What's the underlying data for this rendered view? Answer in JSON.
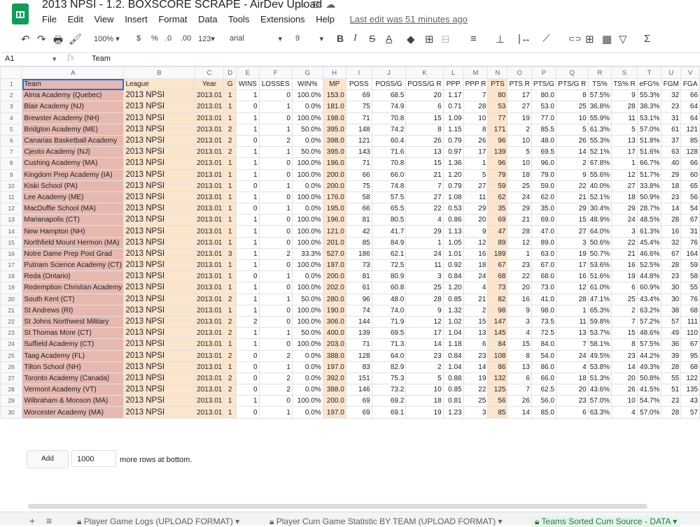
{
  "doc": {
    "title": "2013 NPSI - 1.2. BOXSCORE SCRAPE - AirDev Upload",
    "icons": [
      "star-icon",
      "move-to-folder-icon",
      "cloud-status-icon"
    ]
  },
  "menu": {
    "items": [
      "File",
      "Edit",
      "View",
      "Insert",
      "Format",
      "Data",
      "Tools",
      "Extensions",
      "Help"
    ],
    "last_edit": "Last edit was 51 minutes ago"
  },
  "toolbar": {
    "undo": "↶",
    "redo": "↷",
    "print": "🖶",
    "paint": "🖌",
    "zoom": "100%",
    "currency": "$",
    "percent": "%",
    "dec_less": ".0",
    "dec_more": ".00",
    "format": "123",
    "font": "arial",
    "size": "9",
    "bold": "B",
    "italic": "I",
    "strike": "S",
    "underline": "A",
    "fill": "◆",
    "borders": "⊞",
    "merge": "⊟",
    "halign": "≡",
    "valign": "⊥",
    "wrap": "|↔",
    "rotate": "⟋",
    "link": "⊂⊃",
    "comment": "⊞",
    "chart": "▦",
    "filter": "▽",
    "functions": "Σ"
  },
  "formula_bar": {
    "cell_ref": "A1",
    "value": "Team"
  },
  "columns": [
    "A",
    "B",
    "C",
    "D",
    "E",
    "F",
    "G",
    "H",
    "I",
    "J",
    "K",
    "L",
    "M",
    "N",
    "O",
    "P",
    "Q",
    "R",
    "S",
    "T",
    "U",
    "V"
  ],
  "headers": [
    "Team",
    "League",
    "Year",
    "G",
    "WINS",
    "LOSSES",
    "WIN%",
    "MP",
    "POSS",
    "POSS/G",
    "POSS/G R",
    "PPP",
    "PPP R",
    "PTS",
    "PTS R",
    "PTS/G",
    "PTS/G R",
    "TS%",
    "TS% R",
    "eFG%",
    "FGM",
    "FGA"
  ],
  "rows": [
    [
      "Alma Academy (Quebec)",
      "2013 NPSI",
      "2013.01",
      "1",
      "1",
      "0",
      "100.0%",
      "153.0",
      "69",
      "68.5",
      "20",
      "1.17",
      "7",
      "80",
      "17",
      "80.0",
      "8",
      "57.5%",
      "9",
      "55.3%",
      "32",
      "66"
    ],
    [
      "Blair Academy (NJ)",
      "2013 NPSI",
      "2013.01",
      "1",
      "0",
      "1",
      "0.0%",
      "181.0",
      "75",
      "74.9",
      "6",
      "0.71",
      "28",
      "53",
      "27",
      "53.0",
      "25",
      "36.8%",
      "28",
      "38.3%",
      "23",
      "64"
    ],
    [
      "Brewster Academy (NH)",
      "2013 NPSI",
      "2013.01",
      "1",
      "1",
      "0",
      "100.0%",
      "198.0",
      "71",
      "70.8",
      "15",
      "1.09",
      "10",
      "77",
      "19",
      "77.0",
      "10",
      "55.9%",
      "11",
      "53.1%",
      "31",
      "64"
    ],
    [
      "Bridgton Academy (ME)",
      "2013 NPSI",
      "2013.01",
      "2",
      "1",
      "1",
      "50.0%",
      "395.0",
      "148",
      "74.2",
      "8",
      "1.15",
      "8",
      "171",
      "2",
      "85.5",
      "5",
      "61.3%",
      "5",
      "57.0%",
      "61",
      "121"
    ],
    [
      "Canarias Basketball Academy",
      "2013 NPSI",
      "2013.01",
      "2",
      "0",
      "2",
      "0.0%",
      "398.0",
      "121",
      "60.4",
      "26",
      "0.79",
      "26",
      "96",
      "10",
      "48.0",
      "26",
      "55.3%",
      "13",
      "51.8%",
      "37",
      "85"
    ],
    [
      "Cjeoto Academy (NJ)",
      "2013 NPSI",
      "2013.01",
      "2",
      "1",
      "1",
      "50.0%",
      "395.0",
      "143",
      "71.6",
      "13",
      "0.97",
      "17",
      "139",
      "5",
      "69.5",
      "14",
      "52.1%",
      "17",
      "51.6%",
      "63",
      "128"
    ],
    [
      "Cushing Academy (MA)",
      "2013 NPSI",
      "2013.01",
      "1",
      "1",
      "0",
      "100.0%",
      "196.0",
      "71",
      "70.8",
      "15",
      "1.36",
      "1",
      "96",
      "10",
      "96.0",
      "2",
      "67.8%",
      "1",
      "66.7%",
      "40",
      "66"
    ],
    [
      "Kingdom Prep Academy (IA)",
      "2013 NPSI",
      "2013.01",
      "1",
      "1",
      "0",
      "100.0%",
      "200.0",
      "66",
      "66.0",
      "21",
      "1.20",
      "5",
      "79",
      "18",
      "79.0",
      "9",
      "55.6%",
      "12",
      "51.7%",
      "29",
      "60"
    ],
    [
      "Kiski School (PA)",
      "2013 NPSI",
      "2013.01",
      "1",
      "0",
      "1",
      "0.0%",
      "200.0",
      "75",
      "74.8",
      "7",
      "0.79",
      "27",
      "59",
      "25",
      "59.0",
      "22",
      "40.0%",
      "27",
      "33.8%",
      "18",
      "65"
    ],
    [
      "Lee Academy (ME)",
      "2013 NPSI",
      "2013.01",
      "1",
      "1",
      "0",
      "100.0%",
      "176.0",
      "58",
      "57.5",
      "27",
      "1.08",
      "11",
      "62",
      "24",
      "62.0",
      "21",
      "52.1%",
      "18",
      "50.9%",
      "23",
      "56"
    ],
    [
      "MacDuffie School (MA)",
      "2013 NPSI",
      "2013.01",
      "1",
      "0",
      "1",
      "0.0%",
      "195.0",
      "66",
      "65.5",
      "22",
      "0.53",
      "29",
      "35",
      "29",
      "35.0",
      "29",
      "30.4%",
      "29",
      "28.7%",
      "14",
      "54"
    ],
    [
      "Marianapolis (CT)",
      "2013 NPSI",
      "2013.01",
      "1",
      "1",
      "0",
      "100.0%",
      "196.0",
      "81",
      "80.5",
      "4",
      "0.86",
      "20",
      "69",
      "21",
      "69.0",
      "15",
      "48.9%",
      "24",
      "48.5%",
      "28",
      "67"
    ],
    [
      "New Hampton (NH)",
      "2013 NPSI",
      "2013.01",
      "1",
      "1",
      "0",
      "100.0%",
      "121.0",
      "42",
      "41.7",
      "29",
      "1.13",
      "9",
      "47",
      "28",
      "47.0",
      "27",
      "64.0%",
      "3",
      "61.3%",
      "16",
      "31"
    ],
    [
      "Northfield Mount Hermon (MA)",
      "2013 NPSI",
      "2013.01",
      "1",
      "1",
      "0",
      "100.0%",
      "201.0",
      "85",
      "84.9",
      "1",
      "1.05",
      "12",
      "89",
      "12",
      "89.0",
      "3",
      "50.6%",
      "22",
      "45.4%",
      "32",
      "76"
    ],
    [
      "Notre Dame Prep Post Grad",
      "2013 NPSI",
      "2013.01",
      "3",
      "1",
      "2",
      "33.3%",
      "527.0",
      "186",
      "62.1",
      "24",
      "1.01",
      "16",
      "189",
      "1",
      "63.0",
      "19",
      "50.7%",
      "21",
      "46.6%",
      "67",
      "164"
    ],
    [
      "Putnam Science Academy (CT)",
      "2013 NPSI",
      "2013.01",
      "1",
      "1",
      "0",
      "100.0%",
      "197.0",
      "73",
      "72.5",
      "11",
      "0.92",
      "18",
      "67",
      "23",
      "67.0",
      "17",
      "53.6%",
      "16",
      "52.5%",
      "28",
      "59"
    ],
    [
      "Reda (Ontario)",
      "2013 NPSI",
      "2013.01",
      "1",
      "0",
      "1",
      "0.0%",
      "200.0",
      "81",
      "80.9",
      "3",
      "0.84",
      "24",
      "68",
      "22",
      "68.0",
      "16",
      "51.6%",
      "19",
      "44.8%",
      "23",
      "58"
    ],
    [
      "Redemption Christian Academy",
      "2013 NPSI",
      "2013.01",
      "1",
      "1",
      "0",
      "100.0%",
      "202.0",
      "61",
      "60.8",
      "25",
      "1.20",
      "4",
      "73",
      "20",
      "73.0",
      "12",
      "61.0%",
      "6",
      "60.9%",
      "30",
      "55"
    ],
    [
      "South Kent (CT)",
      "2013 NPSI",
      "2013.01",
      "2",
      "1",
      "1",
      "50.0%",
      "280.0",
      "96",
      "48.0",
      "28",
      "0.85",
      "21",
      "82",
      "16",
      "41.0",
      "28",
      "47.1%",
      "25",
      "43.4%",
      "30",
      "76"
    ],
    [
      "St Andrews (RI)",
      "2013 NPSI",
      "2013.01",
      "1",
      "1",
      "0",
      "100.0%",
      "190.0",
      "74",
      "74.0",
      "9",
      "1.32",
      "2",
      "98",
      "9",
      "98.0",
      "1",
      "65.3%",
      "2",
      "63.2%",
      "38",
      "68"
    ],
    [
      "St Johns Northwest Military",
      "2013 NPSI",
      "2013.01",
      "2",
      "2",
      "0",
      "100.0%",
      "306.0",
      "144",
      "71.9",
      "12",
      "1.02",
      "15",
      "147",
      "3",
      "73.5",
      "11",
      "59.8%",
      "7",
      "57.2%",
      "57",
      "111"
    ],
    [
      "St Thomas More (CT)",
      "2013 NPSI",
      "2013.01",
      "2",
      "1",
      "1",
      "50.0%",
      "400.0",
      "139",
      "69.5",
      "17",
      "1.04",
      "13",
      "145",
      "4",
      "72.5",
      "13",
      "53.7%",
      "15",
      "48.6%",
      "49",
      "110"
    ],
    [
      "Suffield Academy (CT)",
      "2013 NPSI",
      "2013.01",
      "1",
      "1",
      "0",
      "100.0%",
      "203.0",
      "71",
      "71.3",
      "14",
      "1.18",
      "6",
      "84",
      "15",
      "84.0",
      "7",
      "58.1%",
      "8",
      "57.5%",
      "36",
      "67"
    ],
    [
      "Taag Academy (FL)",
      "2013 NPSI",
      "2013.01",
      "2",
      "0",
      "2",
      "0.0%",
      "388.0",
      "128",
      "64.0",
      "23",
      "0.84",
      "23",
      "108",
      "8",
      "54.0",
      "24",
      "49.5%",
      "23",
      "44.2%",
      "39",
      "95"
    ],
    [
      "Tilton School (NH)",
      "2013 NPSI",
      "2013.01",
      "1",
      "0",
      "1",
      "0.0%",
      "197.0",
      "83",
      "82.9",
      "2",
      "1.04",
      "14",
      "86",
      "13",
      "86.0",
      "4",
      "53.8%",
      "14",
      "49.3%",
      "28",
      "68"
    ],
    [
      "Toronto Academy (Canada)",
      "2013 NPSI",
      "2013.01",
      "2",
      "0",
      "2",
      "0.0%",
      "392.0",
      "151",
      "75.3",
      "5",
      "0.88",
      "19",
      "132",
      "6",
      "66.0",
      "18",
      "51.3%",
      "20",
      "50.8%",
      "55",
      "122"
    ],
    [
      "Vermont Academy (VT)",
      "2013 NPSI",
      "2013.01",
      "2",
      "0",
      "2",
      "0.0%",
      "388.0",
      "146",
      "73.2",
      "10",
      "0.85",
      "22",
      "125",
      "7",
      "62.5",
      "20",
      "43.6%",
      "26",
      "41.5%",
      "51",
      "135"
    ],
    [
      "Wilbraham & Monson (MA)",
      "2013 NPSI",
      "2013.01",
      "1",
      "1",
      "0",
      "100.0%",
      "200.0",
      "69",
      "69.2",
      "18",
      "0.81",
      "25",
      "56",
      "26",
      "56.0",
      "23",
      "57.0%",
      "10",
      "54.7%",
      "23",
      "43"
    ],
    [
      "Worcester Academy (MA)",
      "2013 NPSI",
      "2013.01",
      "1",
      "0",
      "1",
      "0.0%",
      "197.0",
      "69",
      "69.1",
      "19",
      "1.23",
      "3",
      "85",
      "14",
      "85.0",
      "6",
      "63.3%",
      "4",
      "57.0%",
      "28",
      "57"
    ]
  ],
  "add_rows": {
    "button": "Add",
    "count": "1000",
    "text": "more rows at bottom."
  },
  "sheetbar": {
    "add": "+",
    "all_sheets": "≡",
    "tabs": [
      {
        "label": "Player Game Logs (UPLOAD FORMAT)"
      },
      {
        "label": "Player Cum Game Statistic BY TEAM (UPLOAD FORMAT)"
      },
      {
        "label": "Teams Sorted Cum Source - DATA"
      }
    ]
  },
  "colors": {
    "team_col": "#e6b8af",
    "tan_col": "#fce5cd",
    "accent_green": "#0f9d58",
    "selection": "#1a73e8"
  }
}
